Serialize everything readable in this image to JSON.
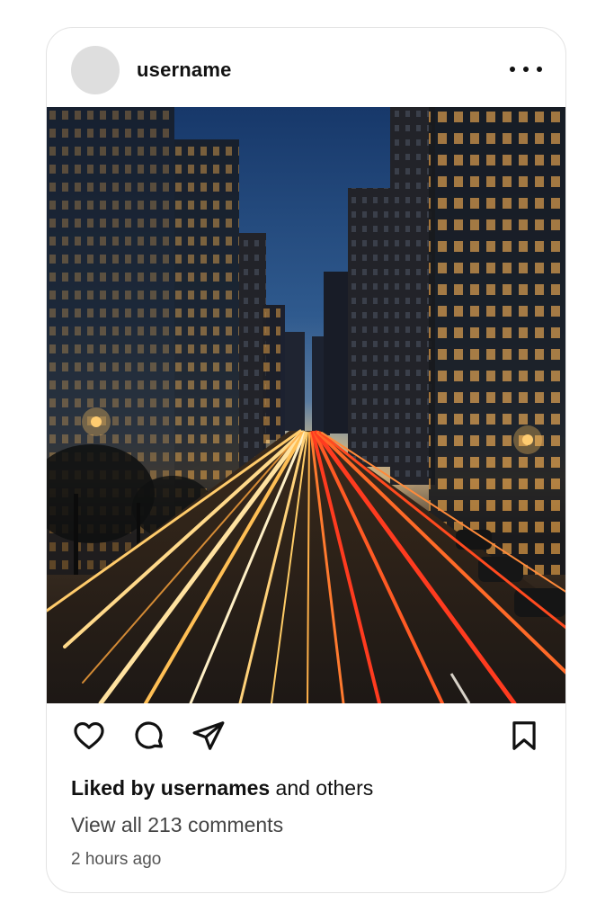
{
  "post": {
    "username": "username",
    "likes_bold": "Liked by usernames",
    "likes_rest": " and others",
    "comments_link": "View all 213 comments",
    "timestamp": "2 hours ago"
  },
  "icons": {
    "more": "more-horizontal-icon",
    "like": "heart-icon",
    "comment": "comment-bubble-icon",
    "share": "send-paper-plane-icon",
    "save": "bookmark-icon"
  },
  "colors": {
    "sky_top": "#1d3f6e",
    "sky_horizon": "#b9a07a",
    "light_trail_warm": "#ffb347",
    "light_trail_red": "#ff3b1f"
  }
}
